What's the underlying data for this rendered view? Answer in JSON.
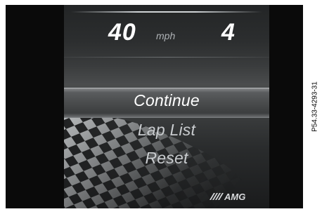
{
  "display": {
    "speed_value": "40",
    "speed_unit": "mph",
    "gear": "4"
  },
  "menu": {
    "items": [
      "Continue",
      "Lap List",
      "Reset"
    ],
    "selected": "Continue"
  },
  "brand_logo": "AMG",
  "figure_code": "P54.33-4293-31",
  "colors": {
    "screen_background": "#0a0a0a",
    "panel_mid": "#4a4c4d",
    "selected_text": "#ffffff",
    "unselected_text": "#c9cccf",
    "highlight_bar": "#5a5c5e"
  },
  "icons": {
    "background": "checkered-flag-icon",
    "logo": "amg-logo-icon"
  }
}
